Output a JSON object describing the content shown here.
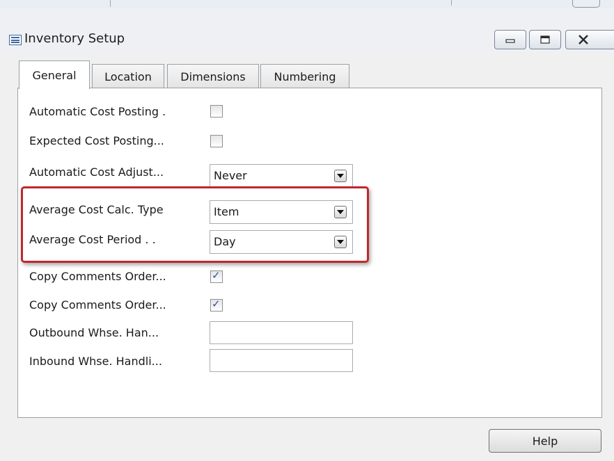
{
  "window": {
    "title": "Inventory Setup",
    "icon": "form-icon",
    "controls": [
      "minimize-icon",
      "maximize-icon",
      "close-icon"
    ]
  },
  "tabs": [
    {
      "label": "General",
      "active": true
    },
    {
      "label": "Location",
      "active": false
    },
    {
      "label": "Dimensions",
      "active": false
    },
    {
      "label": "Numbering",
      "active": false
    }
  ],
  "fields": {
    "automatic_cost_posting": {
      "label": "Automatic Cost Posting  .",
      "checked": false
    },
    "expected_cost_posting": {
      "label": "Expected Cost Posting...",
      "checked": false
    },
    "automatic_cost_adjust": {
      "label": "Automatic Cost Adjust...",
      "value": "Never"
    },
    "average_cost_calc_type": {
      "label": "Average Cost Calc. Type",
      "value": "Item"
    },
    "average_cost_period": {
      "label": "Average Cost Period  .  .",
      "value": "Day"
    },
    "copy_comments_order_1": {
      "label": "Copy Comments Order...",
      "checked": true
    },
    "copy_comments_order_2": {
      "label": "Copy Comments Order...",
      "checked": true
    },
    "outbound_whse": {
      "label": "Outbound Whse. Han...",
      "value": ""
    },
    "inbound_whse": {
      "label": "Inbound Whse. Handli...",
      "value": ""
    }
  },
  "buttons": {
    "help": "Help"
  },
  "colors": {
    "highlight": "#c0272d",
    "checkmark": "#2f4f9c"
  }
}
